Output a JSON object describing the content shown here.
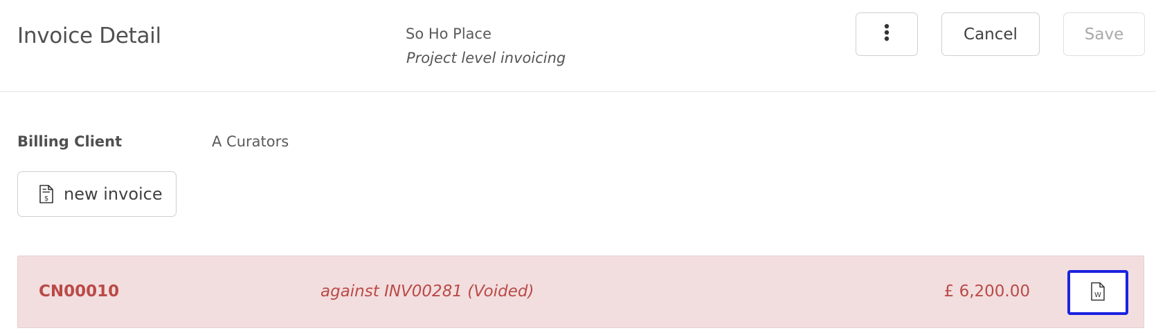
{
  "header": {
    "title": "Invoice Detail",
    "project_name": "So Ho Place",
    "project_subtitle": "Project level invoicing",
    "more_icon": "vertical-ellipsis-icon",
    "cancel_label": "Cancel",
    "save_label": "Save"
  },
  "billing": {
    "label": "Billing Client",
    "value": "A Curators"
  },
  "new_invoice": {
    "label": "new invoice",
    "icon": "invoice-dollar-icon"
  },
  "credit_note": {
    "number": "CN00010",
    "against": "against INV00281 (Voided)",
    "amount": "£ 6,200.00",
    "doc_icon": "word-document-icon",
    "text_color": "#b94a48",
    "background": "#f2dede"
  },
  "colors": {
    "focus_outline": "#1a22e0"
  }
}
